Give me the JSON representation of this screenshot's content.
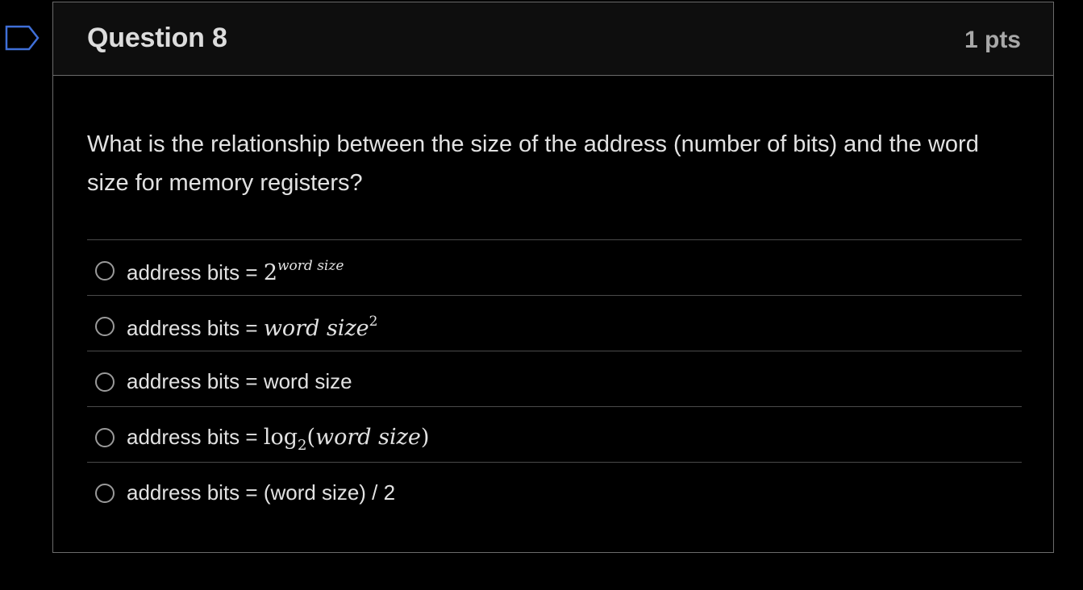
{
  "question": {
    "title": "Question 8",
    "points": "1 pts",
    "text": "What is the relationship between the size of the address (number of bits) and the word size for memory registers?"
  },
  "answers": [
    {
      "prefix": "address bits = ",
      "base": "2",
      "exponent": "word size"
    },
    {
      "prefix": "address bits = ",
      "base": "word size",
      "exponent": "2"
    },
    {
      "prefix": "address bits = ",
      "text": "word size"
    },
    {
      "prefix": "address bits = ",
      "func": "log",
      "subscript": "2",
      "open": "(",
      "arg": "word size",
      "close": ")"
    },
    {
      "prefix": "address bits = ",
      "text": "(word size) / 2"
    }
  ],
  "icons": {
    "flag": "bookmark-flag-icon",
    "radio": "radio-button-icon"
  },
  "colors": {
    "background": "#000000",
    "header_background": "#0e0e0e",
    "border": "#6b6b6b",
    "text": "#e2e2e2",
    "points_text": "#a8a8a8"
  }
}
